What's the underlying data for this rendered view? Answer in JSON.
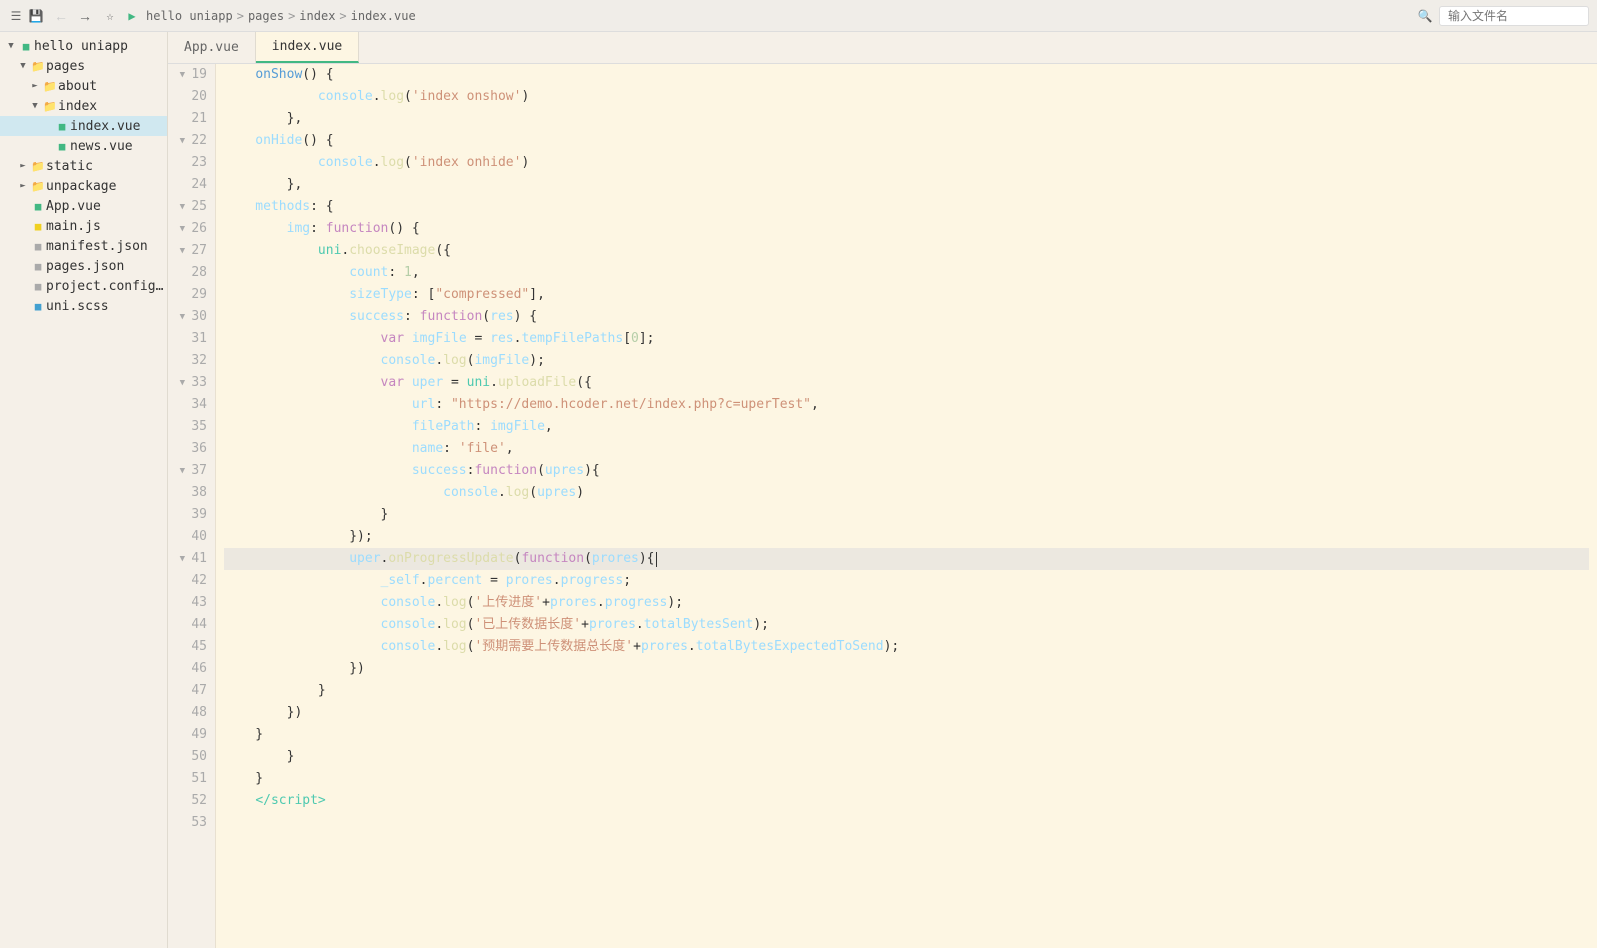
{
  "titlebar": {
    "breadcrumbs": [
      "hello uniapp",
      "pages",
      "index",
      "index.vue"
    ],
    "search_placeholder": "输入文件名"
  },
  "tabs": [
    {
      "label": "App.vue",
      "active": false
    },
    {
      "label": "index.vue",
      "active": true
    }
  ],
  "sidebar": {
    "root_label": "hello uniapp",
    "items": [
      {
        "type": "folder",
        "label": "pages",
        "indent": 1,
        "expanded": true,
        "id": "pages"
      },
      {
        "type": "folder",
        "label": "about",
        "indent": 2,
        "expanded": false,
        "id": "about"
      },
      {
        "type": "folder",
        "label": "index",
        "indent": 2,
        "expanded": true,
        "id": "index"
      },
      {
        "type": "file-vue",
        "label": "index.vue",
        "indent": 3,
        "active": true,
        "id": "index.vue"
      },
      {
        "type": "file-vue",
        "label": "news.vue",
        "indent": 3,
        "id": "news.vue"
      },
      {
        "type": "folder",
        "label": "static",
        "indent": 1,
        "expanded": false,
        "id": "static"
      },
      {
        "type": "folder",
        "label": "unpackage",
        "indent": 1,
        "expanded": false,
        "id": "unpackage"
      },
      {
        "type": "file-vue",
        "label": "App.vue",
        "indent": 1,
        "id": "app.vue"
      },
      {
        "type": "file-js",
        "label": "main.js",
        "indent": 1,
        "id": "main.js"
      },
      {
        "type": "file-json",
        "label": "manifest.json",
        "indent": 1,
        "id": "manifest.json"
      },
      {
        "type": "file-json",
        "label": "pages.json",
        "indent": 1,
        "id": "pages.json"
      },
      {
        "type": "file-json",
        "label": "project.config.json",
        "indent": 1,
        "id": "project.config.json"
      },
      {
        "type": "file-css",
        "label": "uni.scss",
        "indent": 1,
        "id": "uni.scss"
      }
    ]
  },
  "code": {
    "lines": [
      {
        "num": 19,
        "fold": true,
        "content": "onShow() {",
        "tokens": [
          {
            "t": "kw2",
            "v": "onShow"
          },
          {
            "t": "white",
            "v": "() {"
          }
        ]
      },
      {
        "num": 20,
        "content": "    console.log('index onshow')",
        "tokens": [
          {
            "t": "white",
            "v": "        "
          },
          {
            "t": "lightblue",
            "v": "console"
          },
          {
            "t": "white",
            "v": "."
          },
          {
            "t": "yellow",
            "v": "log"
          },
          {
            "t": "white",
            "v": "("
          },
          {
            "t": "str",
            "v": "'index onshow'"
          },
          {
            "t": "white",
            "v": ")"
          }
        ]
      },
      {
        "num": 21,
        "content": "    },",
        "tokens": [
          {
            "t": "white",
            "v": "    },"
          }
        ]
      },
      {
        "num": 22,
        "fold": true,
        "content": "onHide() {",
        "tokens": [
          {
            "t": "kw2",
            "v": "    onHide"
          },
          {
            "t": "white",
            "v": "() {"
          }
        ]
      },
      {
        "num": 23,
        "content": "    console.log('index onhide')",
        "tokens": [
          {
            "t": "white",
            "v": "        "
          },
          {
            "t": "lightblue",
            "v": "console"
          },
          {
            "t": "white",
            "v": "."
          },
          {
            "t": "yellow",
            "v": "log"
          },
          {
            "t": "white",
            "v": "("
          },
          {
            "t": "str",
            "v": "'index onhide'"
          },
          {
            "t": "white",
            "v": ")"
          }
        ]
      },
      {
        "num": 24,
        "content": "    },",
        "tokens": [
          {
            "t": "white",
            "v": "    },"
          }
        ]
      },
      {
        "num": 25,
        "fold": true,
        "content": "methods: {",
        "tokens": [
          {
            "t": "lightblue",
            "v": "    methods"
          },
          {
            "t": "white",
            "v": ": {"
          }
        ]
      },
      {
        "num": 26,
        "fold": true,
        "content": "    img: function() {",
        "tokens": [
          {
            "t": "white",
            "v": "        "
          },
          {
            "t": "lightblue",
            "v": "img"
          },
          {
            "t": "white",
            "v": ": "
          },
          {
            "t": "kw",
            "v": "function"
          },
          {
            "t": "white",
            "v": "() {"
          }
        ]
      },
      {
        "num": 27,
        "fold": true,
        "content": "        uni.chooseImage({",
        "tokens": [
          {
            "t": "white",
            "v": "            "
          },
          {
            "t": "fn2",
            "v": "uni"
          },
          {
            "t": "white",
            "v": "."
          },
          {
            "t": "yellow",
            "v": "chooseImage"
          },
          {
            "t": "white",
            "v": "({"
          }
        ]
      },
      {
        "num": 28,
        "content": "            count: 1,",
        "tokens": [
          {
            "t": "white",
            "v": "                "
          },
          {
            "t": "lightblue",
            "v": "count"
          },
          {
            "t": "white",
            "v": ": "
          },
          {
            "t": "num",
            "v": "1"
          },
          {
            "t": "white",
            "v": ","
          }
        ]
      },
      {
        "num": 29,
        "content": "            sizeType: [\"compressed\"],",
        "tokens": [
          {
            "t": "white",
            "v": "                "
          },
          {
            "t": "lightblue",
            "v": "sizeType"
          },
          {
            "t": "white",
            "v": ": ["
          },
          {
            "t": "str",
            "v": "\"compressed\""
          },
          {
            "t": "white",
            "v": "],"
          }
        ]
      },
      {
        "num": 30,
        "fold": true,
        "content": "            success: function(res) {",
        "tokens": [
          {
            "t": "white",
            "v": "                "
          },
          {
            "t": "lightblue",
            "v": "success"
          },
          {
            "t": "white",
            "v": ": "
          },
          {
            "t": "kw",
            "v": "function"
          },
          {
            "t": "white",
            "v": "("
          },
          {
            "t": "lightblue",
            "v": "res"
          },
          {
            "t": "white",
            "v": ") {"
          }
        ]
      },
      {
        "num": 31,
        "content": "                var imgFile = res.tempFilePaths[0];",
        "tokens": [
          {
            "t": "white",
            "v": "                    "
          },
          {
            "t": "kw",
            "v": "var"
          },
          {
            "t": "white",
            "v": " "
          },
          {
            "t": "lightblue",
            "v": "imgFile"
          },
          {
            "t": "white",
            "v": " = "
          },
          {
            "t": "lightblue",
            "v": "res"
          },
          {
            "t": "white",
            "v": "."
          },
          {
            "t": "lightblue",
            "v": "tempFilePaths"
          },
          {
            "t": "white",
            "v": "["
          },
          {
            "t": "num",
            "v": "0"
          },
          {
            "t": "white",
            "v": "];"
          }
        ]
      },
      {
        "num": 32,
        "content": "                console.log(imgFile);",
        "tokens": [
          {
            "t": "white",
            "v": "                    "
          },
          {
            "t": "lightblue",
            "v": "console"
          },
          {
            "t": "white",
            "v": "."
          },
          {
            "t": "yellow",
            "v": "log"
          },
          {
            "t": "white",
            "v": "("
          },
          {
            "t": "lightblue",
            "v": "imgFile"
          },
          {
            "t": "white",
            "v": ");"
          }
        ]
      },
      {
        "num": 33,
        "fold": true,
        "content": "                var uper = uni.uploadFile({",
        "tokens": [
          {
            "t": "white",
            "v": "                    "
          },
          {
            "t": "kw",
            "v": "var"
          },
          {
            "t": "white",
            "v": " "
          },
          {
            "t": "lightblue",
            "v": "uper"
          },
          {
            "t": "white",
            "v": " = "
          },
          {
            "t": "fn2",
            "v": "uni"
          },
          {
            "t": "white",
            "v": "."
          },
          {
            "t": "yellow",
            "v": "uploadFile"
          },
          {
            "t": "white",
            "v": "({"
          }
        ]
      },
      {
        "num": 34,
        "content": "                    url: \"https://demo.hcoder.net/index.php?c=uperTest\",",
        "tokens": [
          {
            "t": "white",
            "v": "                        "
          },
          {
            "t": "lightblue",
            "v": "url"
          },
          {
            "t": "white",
            "v": ": "
          },
          {
            "t": "str",
            "v": "\"https://demo.hcoder.net/index.php?c=uperTest\""
          },
          {
            "t": "white",
            "v": ","
          }
        ]
      },
      {
        "num": 35,
        "content": "                    filePath: imgFile,",
        "tokens": [
          {
            "t": "white",
            "v": "                        "
          },
          {
            "t": "lightblue",
            "v": "filePath"
          },
          {
            "t": "white",
            "v": ": "
          },
          {
            "t": "lightblue",
            "v": "imgFile"
          },
          {
            "t": "white",
            "v": ","
          }
        ]
      },
      {
        "num": 36,
        "content": "                    name: 'file',",
        "tokens": [
          {
            "t": "white",
            "v": "                        "
          },
          {
            "t": "lightblue",
            "v": "name"
          },
          {
            "t": "white",
            "v": ": "
          },
          {
            "t": "str",
            "v": "'file'"
          },
          {
            "t": "white",
            "v": ","
          }
        ]
      },
      {
        "num": 37,
        "fold": true,
        "content": "                    success:function(upres){",
        "tokens": [
          {
            "t": "white",
            "v": "                        "
          },
          {
            "t": "lightblue",
            "v": "success"
          },
          {
            "t": "white",
            "v": ":"
          },
          {
            "t": "kw",
            "v": "function"
          },
          {
            "t": "white",
            "v": "("
          },
          {
            "t": "lightblue",
            "v": "upres"
          },
          {
            "t": "white",
            "v": "){"
          }
        ]
      },
      {
        "num": 38,
        "content": "                        console.log(upres)",
        "tokens": [
          {
            "t": "white",
            "v": "                            "
          },
          {
            "t": "lightblue",
            "v": "console"
          },
          {
            "t": "white",
            "v": "."
          },
          {
            "t": "yellow",
            "v": "log"
          },
          {
            "t": "white",
            "v": "("
          },
          {
            "t": "lightblue",
            "v": "upres"
          },
          {
            "t": "white",
            "v": ")"
          }
        ]
      },
      {
        "num": 39,
        "content": "                    }",
        "tokens": [
          {
            "t": "white",
            "v": "                    }"
          }
        ]
      },
      {
        "num": 40,
        "content": "                });",
        "tokens": [
          {
            "t": "white",
            "v": "                });"
          }
        ]
      },
      {
        "num": 41,
        "fold": true,
        "content": "                uper.onProgressUpdate(function(prores){ |",
        "active": true,
        "tokens": [
          {
            "t": "white",
            "v": "                "
          },
          {
            "t": "lightblue",
            "v": "uper"
          },
          {
            "t": "white",
            "v": "."
          },
          {
            "t": "yellow",
            "v": "onProgressUpdate"
          },
          {
            "t": "white",
            "v": "("
          },
          {
            "t": "kw",
            "v": "function"
          },
          {
            "t": "white",
            "v": "("
          },
          {
            "t": "lightblue",
            "v": "prores"
          },
          {
            "t": "white",
            "v": "){"
          },
          {
            "t": "cursor",
            "v": ""
          }
        ]
      },
      {
        "num": 42,
        "content": "                    _self.percent = prores.progress;",
        "tokens": [
          {
            "t": "white",
            "v": "                    "
          },
          {
            "t": "lightblue",
            "v": "_self"
          },
          {
            "t": "white",
            "v": "."
          },
          {
            "t": "lightblue",
            "v": "percent"
          },
          {
            "t": "white",
            "v": " = "
          },
          {
            "t": "lightblue",
            "v": "prores"
          },
          {
            "t": "white",
            "v": "."
          },
          {
            "t": "lightblue",
            "v": "progress"
          },
          {
            "t": "white",
            "v": ";"
          }
        ]
      },
      {
        "num": 43,
        "content": "                    console.log('上传进度'+prores.progress);",
        "tokens": [
          {
            "t": "white",
            "v": "                    "
          },
          {
            "t": "lightblue",
            "v": "console"
          },
          {
            "t": "white",
            "v": "."
          },
          {
            "t": "yellow",
            "v": "log"
          },
          {
            "t": "white",
            "v": "("
          },
          {
            "t": "str",
            "v": "'上传进度'"
          },
          {
            "t": "white",
            "v": "+"
          },
          {
            "t": "lightblue",
            "v": "prores"
          },
          {
            "t": "white",
            "v": "."
          },
          {
            "t": "lightblue",
            "v": "progress"
          },
          {
            "t": "white",
            "v": ");"
          }
        ]
      },
      {
        "num": 44,
        "content": "                    console.log('已上传数据长度'+prores.totalBytesSent);",
        "tokens": [
          {
            "t": "white",
            "v": "                    "
          },
          {
            "t": "lightblue",
            "v": "console"
          },
          {
            "t": "white",
            "v": "."
          },
          {
            "t": "yellow",
            "v": "log"
          },
          {
            "t": "white",
            "v": "("
          },
          {
            "t": "str",
            "v": "'已上传数据长度'"
          },
          {
            "t": "white",
            "v": "+"
          },
          {
            "t": "lightblue",
            "v": "prores"
          },
          {
            "t": "white",
            "v": "."
          },
          {
            "t": "lightblue",
            "v": "totalBytesSent"
          },
          {
            "t": "white",
            "v": ");"
          }
        ]
      },
      {
        "num": 45,
        "content": "                    console.log('预期需要上传数据总长度'+prores.totalBytesExpectedToSend);",
        "tokens": [
          {
            "t": "white",
            "v": "                    "
          },
          {
            "t": "lightblue",
            "v": "console"
          },
          {
            "t": "white",
            "v": "."
          },
          {
            "t": "yellow",
            "v": "log"
          },
          {
            "t": "white",
            "v": "("
          },
          {
            "t": "str",
            "v": "'预期需要上传数据总长度'"
          },
          {
            "t": "white",
            "v": "+"
          },
          {
            "t": "lightblue",
            "v": "prores"
          },
          {
            "t": "white",
            "v": "."
          },
          {
            "t": "lightblue",
            "v": "totalBytesExpectedToSend"
          },
          {
            "t": "white",
            "v": ");"
          }
        ]
      },
      {
        "num": 46,
        "content": "                })",
        "tokens": [
          {
            "t": "white",
            "v": "                })"
          }
        ]
      },
      {
        "num": 47,
        "content": "            }",
        "tokens": [
          {
            "t": "white",
            "v": "            }"
          }
        ]
      },
      {
        "num": 48,
        "content": "        })",
        "tokens": [
          {
            "t": "white",
            "v": "        })"
          }
        ]
      },
      {
        "num": 49,
        "content": "    }",
        "tokens": [
          {
            "t": "white",
            "v": "    }"
          }
        ]
      },
      {
        "num": 50,
        "content": "}",
        "tokens": [
          {
            "t": "white",
            "v": "        }"
          }
        ]
      },
      {
        "num": 51,
        "content": "    }",
        "tokens": [
          {
            "t": "white",
            "v": "    }"
          }
        ]
      },
      {
        "num": 52,
        "content": "}",
        "tokens": [
          {
            "t": "white",
            "v": "    "
          },
          {
            "t": "tag",
            "v": "</script"
          },
          {
            "t": "tag",
            "v": ">"
          }
        ]
      },
      {
        "num": 53,
        "content": "",
        "tokens": []
      }
    ]
  }
}
